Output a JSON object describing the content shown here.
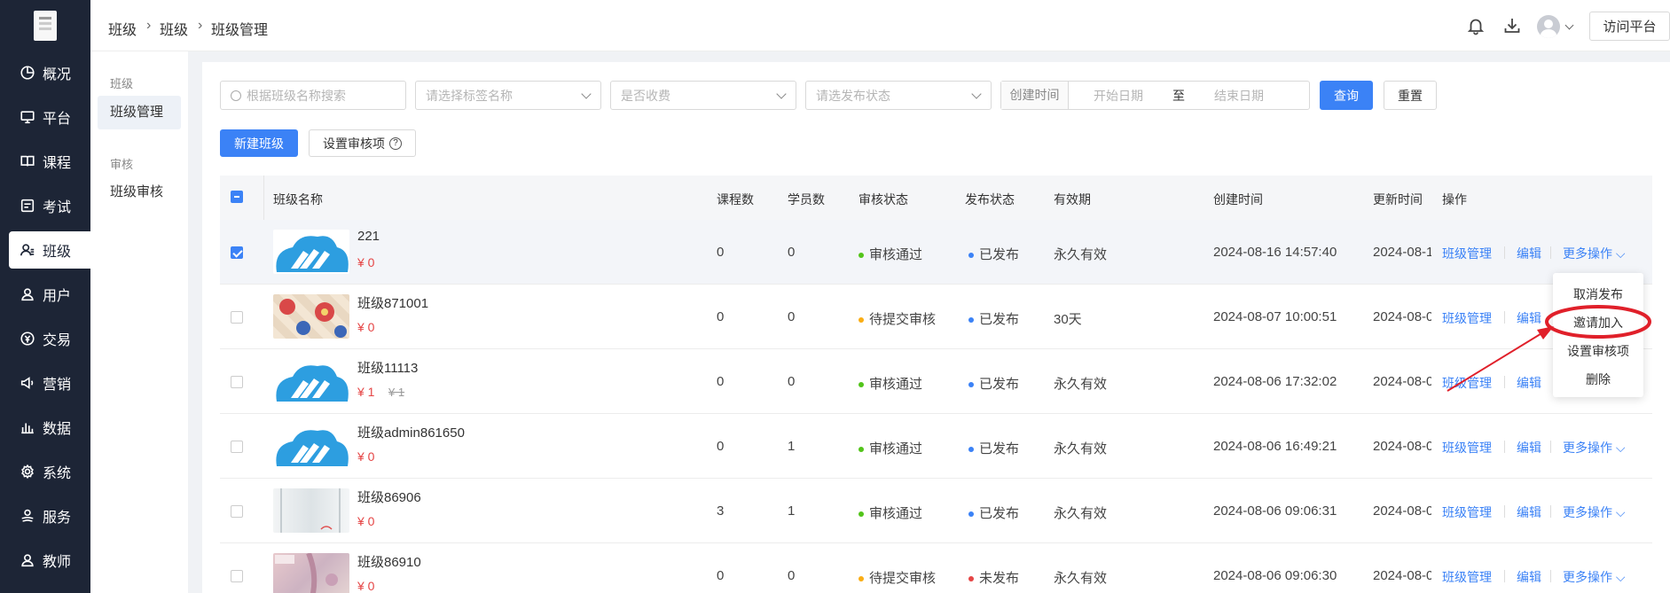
{
  "nav": {
    "items": [
      {
        "label": "概况",
        "icon": "pie-chart-icon"
      },
      {
        "label": "平台",
        "icon": "monitor-icon"
      },
      {
        "label": "课程",
        "icon": "book-icon"
      },
      {
        "label": "考试",
        "icon": "exam-icon"
      },
      {
        "label": "班级",
        "icon": "users-icon"
      },
      {
        "label": "用户",
        "icon": "user-icon"
      },
      {
        "label": "交易",
        "icon": "currency-icon"
      },
      {
        "label": "营销",
        "icon": "megaphone-icon"
      },
      {
        "label": "数据",
        "icon": "bar-chart-icon"
      },
      {
        "label": "系统",
        "icon": "gear-icon"
      },
      {
        "label": "服务",
        "icon": "service-icon"
      },
      {
        "label": "教师",
        "icon": "teacher-icon"
      }
    ],
    "active": "班级"
  },
  "subnav": {
    "group1": "班级",
    "item1": "班级管理",
    "group2": "审核",
    "item2": "班级审核"
  },
  "breadcrumb": [
    "班级",
    "班级",
    "班级管理"
  ],
  "topbar": {
    "visit_label": "访问平台"
  },
  "filters": {
    "search_placeholder": "根据班级名称搜索",
    "tag_placeholder": "请选择标签名称",
    "fee_placeholder": "是否收费",
    "status_placeholder": "请选发布状态",
    "date_label": "创建时间",
    "start_placeholder": "开始日期",
    "date_sep": "至",
    "end_placeholder": "结束日期",
    "query_label": "查询",
    "reset_label": "重置"
  },
  "actions": {
    "new_label": "新建班级",
    "audit_label": "设置审核项"
  },
  "table": {
    "headers": [
      "班级名称",
      "课程数",
      "学员数",
      "审核状态",
      "发布状态",
      "有效期",
      "创建时间",
      "更新时间",
      "操作"
    ],
    "rows": [
      {
        "name": "221",
        "price": "¥ 0",
        "price_old": "",
        "courses": "0",
        "students": "0",
        "audit": "审核通过",
        "audit_color": "#52c41a",
        "publish": "已发布",
        "publish_color": "#3b82f6",
        "valid": "永久有效",
        "created": "2024-08-16 14:57:40",
        "updated": "2024-08-1",
        "checked": true,
        "thumb": "cloud"
      },
      {
        "name": "班级871001",
        "price": "¥ 0",
        "price_old": "",
        "courses": "0",
        "students": "0",
        "audit": "待提交审核",
        "audit_color": "#faad14",
        "publish": "已发布",
        "publish_color": "#3b82f6",
        "valid": "30天",
        "created": "2024-08-07 10:00:51",
        "updated": "2024-08-0",
        "checked": false,
        "thumb": "floral"
      },
      {
        "name": "班级11113",
        "price": "¥ 1",
        "price_old": "¥ 1",
        "courses": "0",
        "students": "0",
        "audit": "审核通过",
        "audit_color": "#52c41a",
        "publish": "已发布",
        "publish_color": "#3b82f6",
        "valid": "永久有效",
        "created": "2024-08-06 17:32:02",
        "updated": "2024-08-0",
        "checked": false,
        "thumb": "cloud"
      },
      {
        "name": "班级admin861650",
        "price": "¥ 0",
        "price_old": "",
        "courses": "0",
        "students": "1",
        "audit": "审核通过",
        "audit_color": "#52c41a",
        "publish": "已发布",
        "publish_color": "#3b82f6",
        "valid": "永久有效",
        "created": "2024-08-06 16:49:21",
        "updated": "2024-08-0",
        "checked": false,
        "thumb": "cloud"
      },
      {
        "name": "班级86906",
        "price": "¥ 0",
        "price_old": "",
        "courses": "3",
        "students": "1",
        "audit": "审核通过",
        "audit_color": "#52c41a",
        "publish": "已发布",
        "publish_color": "#3b82f6",
        "valid": "永久有效",
        "created": "2024-08-06 09:06:31",
        "updated": "2024-08-0",
        "checked": false,
        "thumb": "paper"
      },
      {
        "name": "班级86910",
        "price": "¥ 0",
        "price_old": "",
        "courses": "0",
        "students": "0",
        "audit": "待提交审核",
        "audit_color": "#faad14",
        "publish": "未发布",
        "publish_color": "#e54545",
        "valid": "永久有效",
        "created": "2024-08-06 09:06:30",
        "updated": "2024-08-0",
        "checked": false,
        "thumb": "pink"
      }
    ],
    "op_manage": "班级管理",
    "op_edit": "编辑",
    "op_more": "更多操作"
  },
  "dropdown": [
    "取消发布",
    "邀请加入",
    "设置审核项",
    "删除"
  ],
  "colors": {
    "sidebar": "#1d2536",
    "primary": "#3b82f6",
    "annotation": "#e0202a"
  }
}
